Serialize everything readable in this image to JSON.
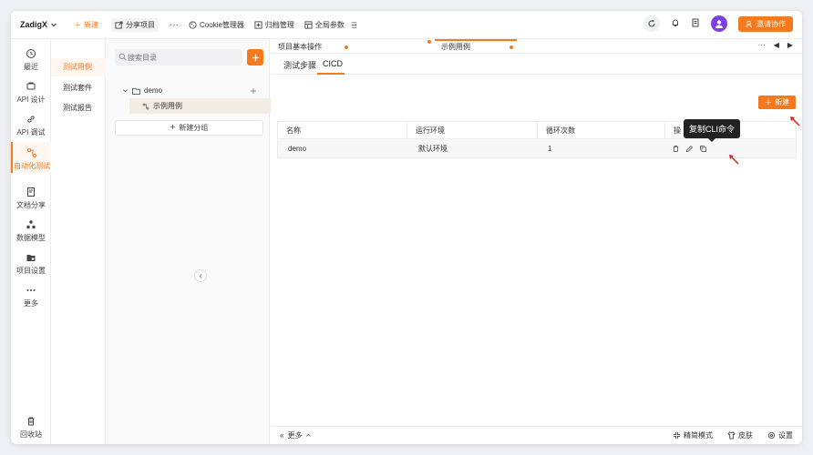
{
  "header": {
    "brand": "ZadigX",
    "new_label": "新建",
    "share_label": "分享项目",
    "more_label": "···",
    "cookie_label": "Cookie管理器",
    "archive_label": "归档管理",
    "global_label": "全局参数",
    "invite_label": "邀请协作"
  },
  "sidebar": {
    "items": [
      {
        "label": "最近",
        "icon": "clock-icon"
      },
      {
        "label": "API 设计",
        "icon": "api-design-icon"
      },
      {
        "label": "API 调试",
        "icon": "link-icon"
      },
      {
        "label": "自动化测试",
        "icon": "flow-icon"
      },
      {
        "label": "文档分享",
        "icon": "doc-share-icon"
      },
      {
        "label": "数据模型",
        "icon": "model-icon"
      },
      {
        "label": "项目设置",
        "icon": "folder-settings-icon"
      },
      {
        "label": "更多",
        "icon": "more-icon"
      }
    ],
    "trash_label": "回收站"
  },
  "col2": {
    "items": [
      "测试用例",
      "测试套件",
      "测试报告"
    ]
  },
  "tree": {
    "search_placeholder": "搜索目录",
    "folder": "demo",
    "case": "示例用例",
    "new_group": "新建分组"
  },
  "main": {
    "open_tabs": [
      "项目基本操作",
      "示例用例"
    ],
    "tab_more": "···",
    "subtabs": [
      "测试步骤",
      "CICD"
    ],
    "new_button": "新建",
    "columns": [
      "名称",
      "运行环境",
      "循环次数",
      "操"
    ],
    "rows": [
      {
        "name": "demo",
        "env": "默认环境",
        "loops": "1"
      }
    ],
    "tooltip": "复制CLI命令"
  },
  "footer": {
    "more": "更多",
    "simple_mode": "精简模式",
    "skin": "皮肤",
    "settings": "设置"
  },
  "colors": {
    "accent": "#f5791f",
    "avatar": "#7b3fe4"
  }
}
